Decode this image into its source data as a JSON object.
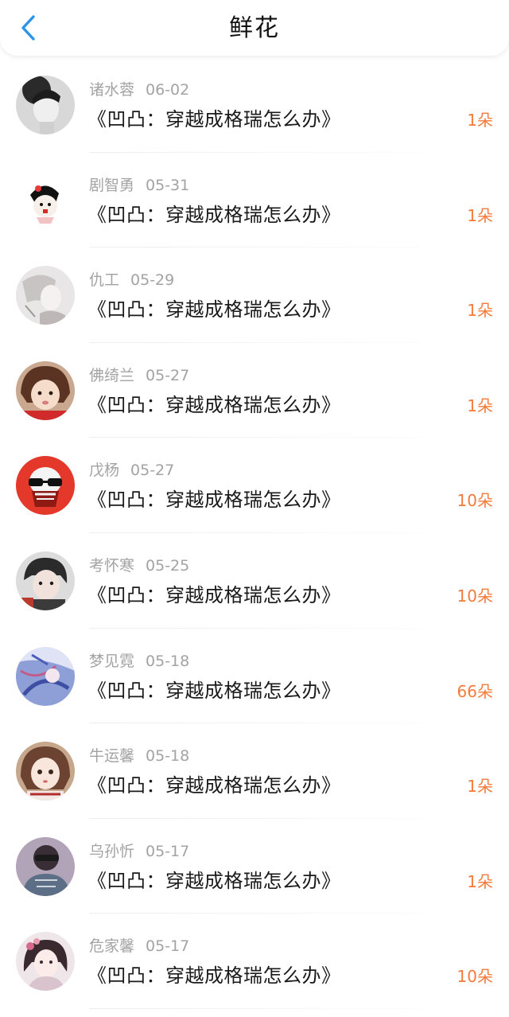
{
  "header": {
    "back_icon": "chevron-left-icon",
    "title": "鲜花",
    "accent_color": "#2a93ec"
  },
  "flower_count_color": "#f47b3b",
  "items": [
    {
      "name": "诸水蓉",
      "date": "06-02",
      "book": "《凹凸：穿越成格瑞怎么办》",
      "count": "1朵",
      "avatar": "bw-portrait-avatar"
    },
    {
      "name": "剧智勇",
      "date": "05-31",
      "book": "《凹凸：穿越成格瑞怎么办》",
      "count": "1朵",
      "avatar": "cartoon-avatar"
    },
    {
      "name": "仇工",
      "date": "05-29",
      "book": "《凹凸：穿越成格瑞怎么办》",
      "count": "1朵",
      "avatar": "anime-sketch-avatar"
    },
    {
      "name": "佛绮兰",
      "date": "05-27",
      "book": "《凹凸：穿越成格瑞怎么办》",
      "count": "1朵",
      "avatar": "child-avatar"
    },
    {
      "name": "戊杨",
      "date": "05-27",
      "book": "《凹凸：穿越成格瑞怎么办》",
      "count": "10朵",
      "avatar": "skull-avatar"
    },
    {
      "name": "考怀寒",
      "date": "05-25",
      "book": "《凹凸：穿越成格瑞怎么办》",
      "count": "10朵",
      "avatar": "young-man-avatar"
    },
    {
      "name": "梦见霓",
      "date": "05-18",
      "book": "《凹凸：穿越成格瑞怎么办》",
      "count": "66朵",
      "avatar": "anime-blue-avatar"
    },
    {
      "name": "牛运馨",
      "date": "05-18",
      "book": "《凹凸：穿越成格瑞怎么办》",
      "count": "1朵",
      "avatar": "doll-avatar"
    },
    {
      "name": "乌孙忻",
      "date": "05-17",
      "book": "《凹凸：穿越成格瑞怎么办》",
      "count": "1朵",
      "avatar": "blurred-face-avatar"
    },
    {
      "name": "危家馨",
      "date": "05-17",
      "book": "《凹凸：穿越成格瑞怎么办》",
      "count": "10朵",
      "avatar": "chinese-style-avatar"
    }
  ]
}
